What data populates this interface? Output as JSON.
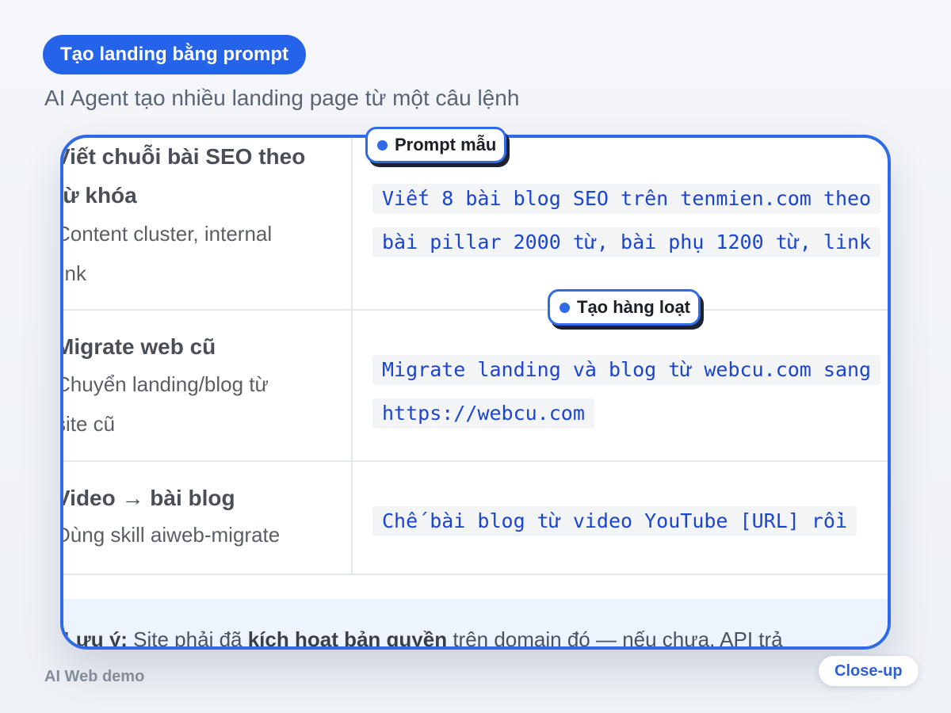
{
  "header": {
    "badge_label": "Tạo landing bằng prompt",
    "subtitle": "AI Agent tạo nhiều landing page từ một câu lệnh"
  },
  "rows": [
    {
      "title": "Viết chuỗi bài SEO theo",
      "title_line2": "từ khóa",
      "desc_line1": "Content cluster, internal",
      "desc_line2": "link",
      "code_line1": "Viết 8 bài blog SEO trên tenmien.com theo",
      "code_line2": "bài pillar 2000 từ, bài phụ 1200 từ, link"
    },
    {
      "title": "Migrate web cũ",
      "desc_line1": "Chuyển landing/blog từ",
      "desc_line2": "site cũ",
      "code_line1": "Migrate landing và blog từ webcu.com sang",
      "code_line2": "https://webcu.com"
    },
    {
      "title": "Video → bài blog",
      "desc_line1": "Dùng skill aiweb-migrate",
      "code_line1": "Chế bài blog từ video YouTube [URL] rồi"
    }
  ],
  "note": {
    "label": "Lưu ý:",
    "text_1": " Site phải đã ",
    "bold": "kích hoạt bản quyền",
    "text_2": " trên domain đó — nếu chưa, API trả"
  },
  "tags": {
    "prompt": "Prompt mẫu",
    "batch": "Tạo hàng loạt"
  },
  "footer": {
    "caption": "AI Web demo",
    "closeup_label": "Close-up"
  },
  "colors": {
    "accent": "#2563eb",
    "code_text": "#1b45cf",
    "background": "#f4f6fa"
  }
}
